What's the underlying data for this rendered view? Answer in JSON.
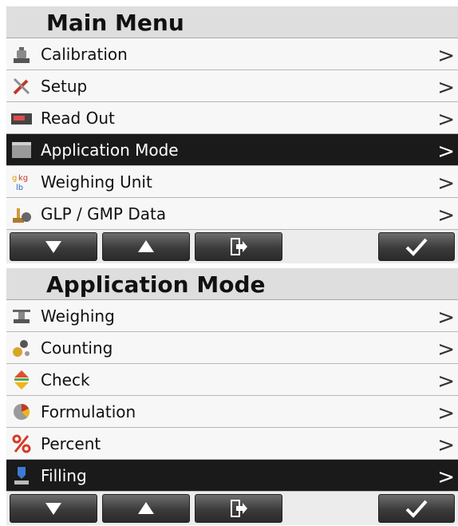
{
  "main_menu": {
    "title": "Main Menu",
    "items": [
      {
        "label": "Calibration",
        "icon": "calibration-weight-icon",
        "selected": false
      },
      {
        "label": "Setup",
        "icon": "setup-tools-icon",
        "selected": false
      },
      {
        "label": "Read Out",
        "icon": "readout-display-icon",
        "selected": false
      },
      {
        "label": "Application Mode",
        "icon": "application-mode-icon",
        "selected": true
      },
      {
        "label": "Weighing Unit",
        "icon": "weighing-unit-icon",
        "selected": false
      },
      {
        "label": "GLP / GMP Data",
        "icon": "glp-gmp-icon",
        "selected": false
      }
    ],
    "chevron": ">"
  },
  "app_menu": {
    "title": "Application Mode",
    "items": [
      {
        "label": "Weighing",
        "icon": "weighing-scale-icon",
        "selected": false
      },
      {
        "label": "Counting",
        "icon": "counting-icon",
        "selected": false
      },
      {
        "label": "Check",
        "icon": "check-arrows-icon",
        "selected": false
      },
      {
        "label": "Formulation",
        "icon": "formulation-icon",
        "selected": false
      },
      {
        "label": "Percent",
        "icon": "percent-icon",
        "selected": false
      },
      {
        "label": "Filling",
        "icon": "filling-icon",
        "selected": true
      }
    ],
    "chevron": ">"
  },
  "buttons": [
    "down-arrow-icon",
    "up-arrow-icon",
    "exit-icon",
    "checkmark-icon"
  ],
  "colors": {
    "selected_bg": "#1a1a1a",
    "title_bg": "#dedede",
    "row_bg": "#f7f7f7"
  }
}
